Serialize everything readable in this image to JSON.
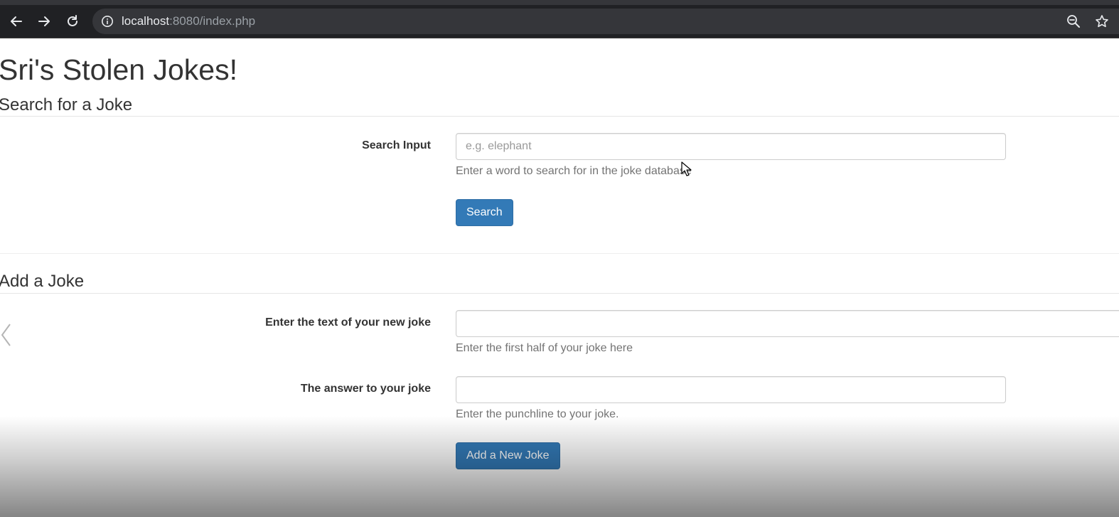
{
  "browser": {
    "url_host": "localhost",
    "url_rest": ":8080/index.php",
    "icons": {
      "back": "back-arrow-icon",
      "forward": "forward-arrow-icon",
      "reload": "reload-icon",
      "info": "info-icon",
      "zoom": "zoom-out-icon",
      "bookmark": "star-icon"
    }
  },
  "page": {
    "title": "Sri's Stolen Jokes!",
    "search_section": {
      "heading": "Search for a Joke",
      "input_label": "Search Input",
      "input_placeholder": "e.g. elephant",
      "input_value": "",
      "help_text": "Enter a word to search for in the joke database",
      "button_label": "Search"
    },
    "add_section": {
      "heading": "Add a Joke",
      "joke_label": "Enter the text of your new joke",
      "joke_value": "",
      "joke_help": "Enter the first half of your joke here",
      "answer_label": "The answer to your joke",
      "answer_value": "",
      "answer_help": "Enter the punchline to your joke.",
      "button_label": "Add a New Joke"
    }
  },
  "colors": {
    "primary_button": "#337ab7",
    "browser_chrome": "#202124",
    "omnibox": "#35363a"
  }
}
